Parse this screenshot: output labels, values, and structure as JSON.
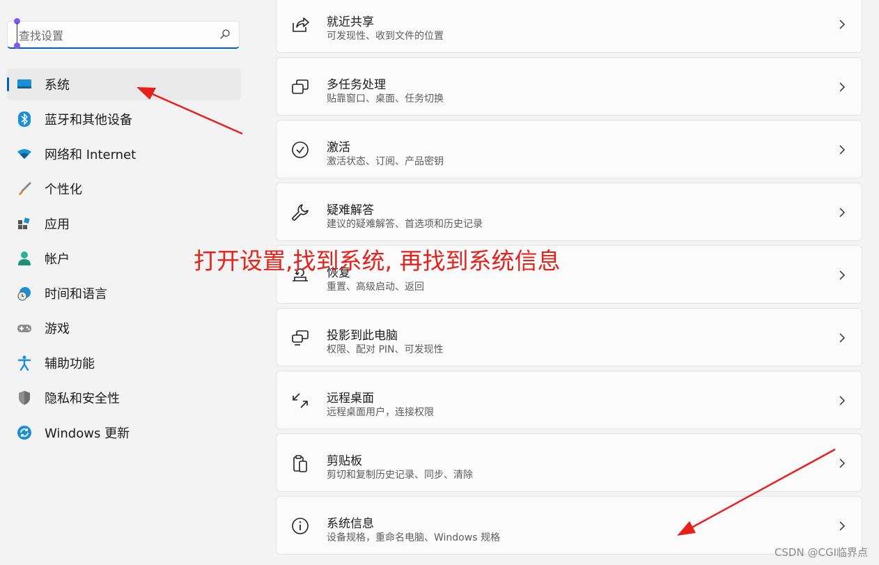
{
  "search": {
    "placeholder": "查找设置"
  },
  "sidebar": {
    "items": [
      {
        "label": "系统",
        "icon": "monitor-icon"
      },
      {
        "label": "蓝牙和其他设备",
        "icon": "bluetooth-icon"
      },
      {
        "label": "网络和 Internet",
        "icon": "wifi-icon"
      },
      {
        "label": "个性化",
        "icon": "paintbrush-icon"
      },
      {
        "label": "应用",
        "icon": "apps-icon"
      },
      {
        "label": "帐户",
        "icon": "account-icon"
      },
      {
        "label": "时间和语言",
        "icon": "globe-clock-icon"
      },
      {
        "label": "游戏",
        "icon": "gamepad-icon"
      },
      {
        "label": "辅助功能",
        "icon": "accessibility-icon"
      },
      {
        "label": "隐私和安全性",
        "icon": "shield-icon"
      },
      {
        "label": "Windows 更新",
        "icon": "update-icon"
      }
    ]
  },
  "cards": [
    {
      "title": "就近共享",
      "subtitle": "可发现性、收到文件的位置",
      "icon": "share-icon"
    },
    {
      "title": "多任务处理",
      "subtitle": "贴靠窗口、桌面、任务切换",
      "icon": "multitask-icon"
    },
    {
      "title": "激活",
      "subtitle": "激活状态、订阅、产品密钥",
      "icon": "check-circle-icon"
    },
    {
      "title": "疑难解答",
      "subtitle": "建议的疑难解答、首选项和历史记录",
      "icon": "wrench-icon"
    },
    {
      "title": "恢复",
      "subtitle": "重置、高级启动、返回",
      "icon": "recovery-icon"
    },
    {
      "title": "投影到此电脑",
      "subtitle": "权限、配对 PIN、可发现性",
      "icon": "project-icon"
    },
    {
      "title": "远程桌面",
      "subtitle": "远程桌面用户，连接权限",
      "icon": "remote-desktop-icon"
    },
    {
      "title": "剪贴板",
      "subtitle": "剪切和复制历史记录、同步、清除",
      "icon": "clipboard-icon"
    },
    {
      "title": "系统信息",
      "subtitle": "设备规格，重命名电脑、Windows 规格",
      "icon": "info-icon"
    }
  ],
  "annotation": "打开设置,找到系统, 再找到系统信息",
  "watermark": "CSDN @CGI临界点",
  "colors": {
    "accent": "#005fb8",
    "annotation": "#e8201a",
    "background": "#f3f3f3"
  }
}
